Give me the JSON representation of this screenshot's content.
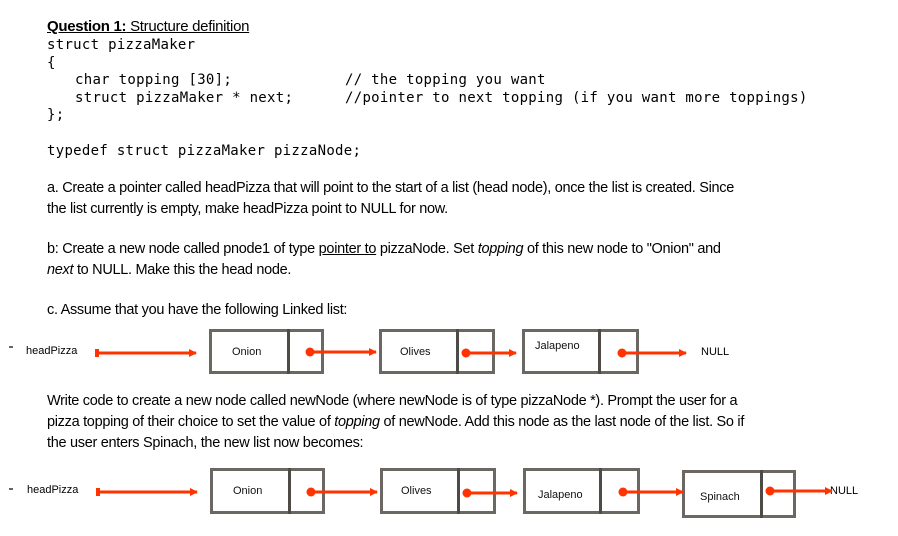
{
  "question": {
    "heading_bold": "Question 1:",
    "heading_rest": " Structure definition",
    "code": {
      "line1": "struct pizzaMaker",
      "line2": "{",
      "line3": "char topping [30];",
      "line4": "struct pizzaMaker * next;",
      "line5": "};",
      "comment3": "// the topping you want",
      "comment4": "//pointer to next topping (if you want more toppings)",
      "typedef": "typedef struct pizzaMaker pizzaNode;"
    }
  },
  "part_a": {
    "line1": "a.  Create a pointer called headPizza that will point to the start of a list (head node), once the list is created. Since",
    "line2": "the list currently is empty, make headPizza point to NULL for now."
  },
  "part_b": {
    "l1_a": "b: Create a new node called pnode1 of type ",
    "l1_u": "pointer to",
    "l1_b": " pizzaNode. Set ",
    "l1_i": "topping",
    "l1_c": " of this new node to \"Onion\" and",
    "l2_i": "next",
    "l2_rest": " to NULL. Make this the head node."
  },
  "part_c": {
    "intro": "c. Assume that you have the following Linked list:",
    "p1": "Write code to create a new node called newNode (where newNode is of type pizzaNode *). Prompt the user for a",
    "p2_a": "pizza topping of their choice to set the value of ",
    "p2_i": "topping",
    "p2_b": " of newNode. Add this node as the last node of the list. So if",
    "p3": "the user enters Spinach, the new list now becomes:"
  },
  "diagram1": {
    "head_label": "headPizza",
    "nodes": [
      "Onion",
      "Olives",
      "Jalapeno"
    ],
    "terminal": "NULL"
  },
  "diagram2": {
    "head_label": "headPizza",
    "nodes": [
      "Onion",
      "Olives",
      "Jalapeno",
      "Spinach"
    ],
    "terminal": "NULL"
  },
  "colors": {
    "arrow": "#ff3300",
    "node_border": "#6b6762"
  }
}
